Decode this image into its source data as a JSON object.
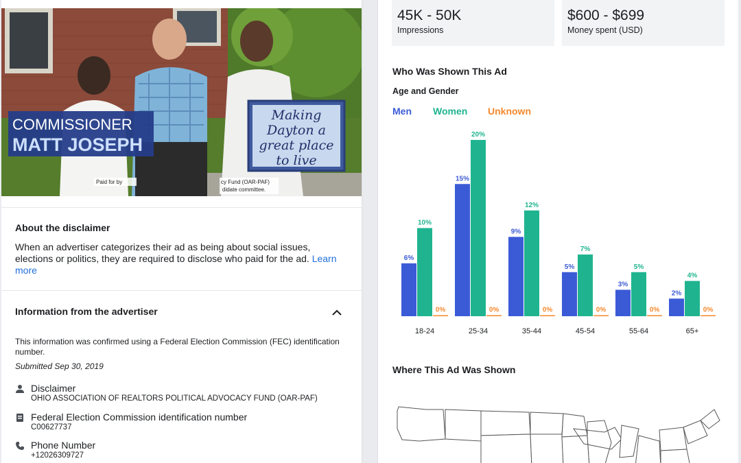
{
  "left": {
    "top_clipped_text": "",
    "ad_image": {
      "name_line1": "COMMISSIONER",
      "name_line2": "MATT JOSEPH",
      "sign_text": [
        "Making",
        "Dayton a",
        "great place",
        "to live"
      ],
      "paid_for_left": "Paid for by",
      "paid_for_right": "cy Fund (OAR-PAF)",
      "paid_for_right2": "didate committee."
    },
    "disclaimer": {
      "title": "About the disclaimer",
      "text": "When an advertiser categorizes their ad as being about social issues, elections or politics, they are required to disclose who paid for the ad.",
      "link": "Learn more"
    },
    "advertiser_info": {
      "title": "Information from the advertiser",
      "confirmation": "This information was confirmed using a Federal Election Commission (FEC) identification number.",
      "submitted": "Submitted Sep 30, 2019",
      "rows": [
        {
          "icon": "person-icon",
          "label": "Disclaimer",
          "value": "OHIO ASSOCIATION OF REALTORS POLITICAL ADVOCACY FUND (OAR-PAF)"
        },
        {
          "icon": "id-card-icon",
          "label": "Federal Election Commission identification number",
          "value": "C00627737"
        },
        {
          "icon": "phone-icon",
          "label": "Phone Number",
          "value": "+12026309727"
        }
      ]
    }
  },
  "right": {
    "impressions": {
      "value": "45K - 50K",
      "caption": "Impressions"
    },
    "spend": {
      "value": "$600 - $699",
      "caption": "Money spent (USD)"
    },
    "who_title": "Who Was Shown This Ad",
    "age_gender_title": "Age and Gender",
    "where_title": "Where This Ad Was Shown"
  },
  "colors": {
    "men": "#3b5bd6",
    "women": "#1fb48f",
    "unknown": "#f5892e"
  },
  "chart_data": {
    "type": "bar",
    "categories": [
      "18-24",
      "25-34",
      "35-44",
      "45-54",
      "55-64",
      "65+"
    ],
    "series": [
      {
        "name": "Men",
        "values": [
          6,
          15,
          9,
          5,
          3,
          2
        ]
      },
      {
        "name": "Women",
        "values": [
          10,
          20,
          12,
          7,
          5,
          4
        ]
      },
      {
        "name": "Unknown",
        "values": [
          0,
          0,
          0,
          0,
          0,
          0
        ]
      }
    ],
    "value_suffix": "%",
    "ylim": [
      0,
      20
    ],
    "grid": false,
    "legend": "top-left"
  }
}
